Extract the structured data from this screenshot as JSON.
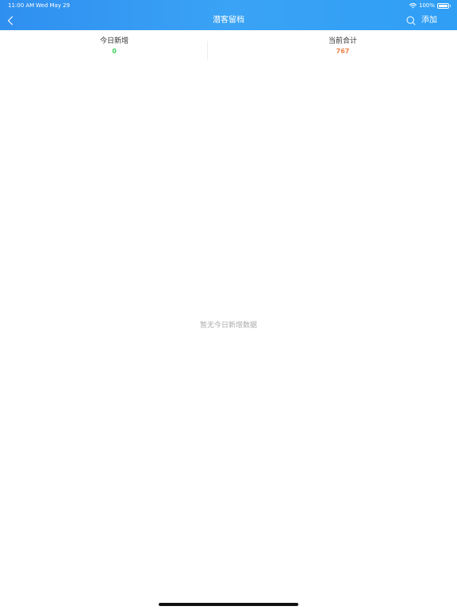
{
  "status_bar": {
    "time": "11:00 AM",
    "date": "Wed May 29",
    "battery": "100%"
  },
  "nav": {
    "title": "潜客留档",
    "add_label": "添加",
    "icons": {
      "back": "chevron-left-icon",
      "search": "search-icon"
    }
  },
  "stats": {
    "today_new": {
      "label": "今日新增",
      "value": "0",
      "color": "#3fd15a"
    },
    "current_total": {
      "label": "当前合计",
      "value": "767",
      "color": "#f0844a"
    }
  },
  "empty_state": {
    "message": "暂无今日新增数据"
  },
  "colors": {
    "header_gradient_start": "#2f8ff0",
    "header_gradient_end": "#2f9ef5"
  }
}
